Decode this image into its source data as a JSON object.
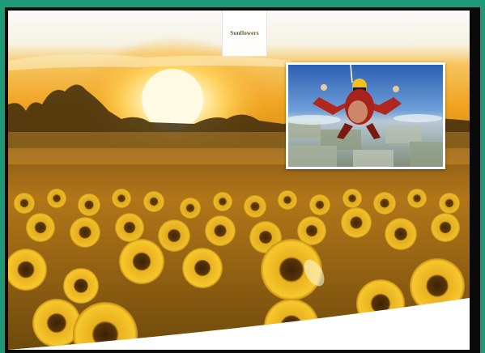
{
  "header": {
    "logo_text": "Sunflowers"
  },
  "colors": {
    "frame": "#1f9a79",
    "sky_top": "#ffffff",
    "sun": "#fff6c8",
    "field": "#d79a1c",
    "curve": "#ffffff"
  },
  "hero": {
    "background_image": "sunflower-field-sunset",
    "inset_image": "tandem-skydiver-freefall"
  }
}
